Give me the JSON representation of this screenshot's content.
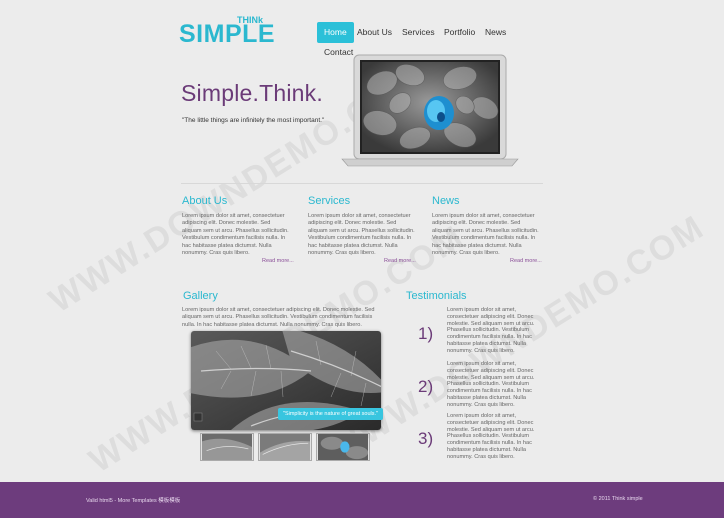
{
  "logo": {
    "main": "SIMPLE",
    "small": "THINk"
  },
  "nav": {
    "items": [
      "Home",
      "About Us",
      "Services",
      "Portfolio",
      "News",
      "Contact"
    ]
  },
  "hero": {
    "title": "Simple.Think.",
    "quote": "\"The little things are infinitely the most important.\""
  },
  "columns": [
    {
      "title": "About Us",
      "text": "Lorem ipsum dolor sit amet, consectetuer adipiscing elit. Donec molestie. Sed aliquam sem ut arcu. Phasellus sollicitudin. Vestibulum condimentum facilisis nulla. In hac habitasse platea dictumst. Nulla nonummy. Cras quis libero.",
      "readmore": "Read more..."
    },
    {
      "title": "Services",
      "text": "Lorem ipsum dolor sit amet, consectetuer adipiscing elit. Donec molestie. Sed aliquam sem ut arcu. Phasellus sollicitudin. Vestibulum condimentum facilisis nulla. In hac habitasse platea dictumst. Nulla nonummy. Cras quis libero.",
      "readmore": "Read more..."
    },
    {
      "title": "News",
      "text": "Lorem ipsum dolor sit amet, consectetuer adipiscing elit. Donec molestie. Sed aliquam sem ut arcu. Phasellus sollicitudin. Vestibulum condimentum facilisis nulla. In hac habitasse platea dictumst. Nulla nonummy. Cras quis libero.",
      "readmore": "Read more..."
    }
  ],
  "gallery": {
    "title": "Gallery",
    "text": "Lorem ipsum dolor sit amet, consectetuer adipiscing elit. Donec molestie. Sed aliquam sem ut arcu. Phasellus sollicitudin. Vestibulum condimentum facilisis nulla. In hac habitasse platea dictumst. Nulla nonummy. Cras quis libero.",
    "caption": "\"Simplicity is the nature of great souls.\""
  },
  "testimonials": {
    "title": "Testimonials",
    "items": [
      {
        "num": "1)",
        "text": "Lorem ipsum dolor sit amet, consectetuer adipiscing elit. Donec molestie. Sed aliquam sem ut arcu. Phasellus sollicitudin. Vestibulum condimentum facilisis nulla. In hac habitasse platea dictumst. Nulla nonummy. Cras quis libero."
      },
      {
        "num": "2)",
        "text": "Lorem ipsum dolor sit amet, consectetuer adipiscing elit. Donec molestie. Sed aliquam sem ut arcu. Phasellus sollicitudin. Vestibulum condimentum facilisis nulla. In hac habitasse platea dictumst. Nulla nonummy. Cras quis libero."
      },
      {
        "num": "3)",
        "text": "Lorem ipsum dolor sit amet, consectetuer adipiscing elit. Donec molestie. Sed aliquam sem ut arcu. Phasellus sollicitudin. Vestibulum condimentum facilisis nulla. In hac habitasse platea dictumst. Nulla nonummy. Cras quis libero."
      }
    ]
  },
  "footer": {
    "left": "Valid html5 - More Templates 模板模板",
    "right": "© 2011 Think simple"
  },
  "watermark": "WWW.DOWNDEMO.COM",
  "colors": {
    "accent": "#2bb8cf",
    "purple": "#6d3c7d",
    "background": "#ececec"
  }
}
